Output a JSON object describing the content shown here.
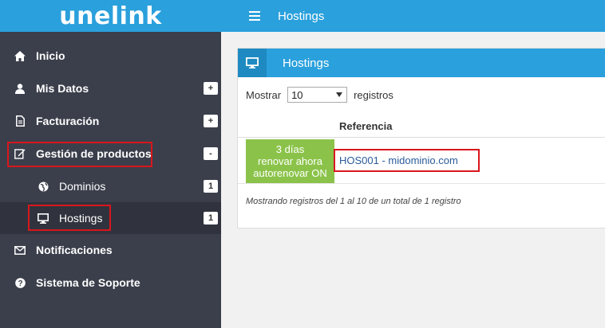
{
  "logo": "unelink",
  "topbar": {
    "title": "Hostings"
  },
  "sidebar": {
    "items": [
      {
        "label": "Inicio"
      },
      {
        "label": "Mis Datos",
        "badge": "+"
      },
      {
        "label": "Facturación",
        "badge": "+"
      },
      {
        "label": "Gestión de productos",
        "badge": "-"
      },
      {
        "label": "Dominios",
        "badge": "1"
      },
      {
        "label": "Hostings",
        "badge": "1"
      },
      {
        "label": "Notificaciones"
      },
      {
        "label": "Sistema de Soporte"
      }
    ]
  },
  "panel": {
    "title": "Hostings",
    "show_label": "Mostrar",
    "show_value": "10",
    "records_label": "registros",
    "column_header": "Referencia",
    "rows": [
      {
        "status": [
          "3 días",
          "renovar ahora",
          "autorenovar ON"
        ],
        "reference": "HOS001 - midominio.com"
      }
    ],
    "info": "Mostrando registros del 1 al 10 de un total de 1 registro"
  },
  "colors": {
    "brand": "#2aa0dc",
    "sidebar": "#3b3f4b",
    "status_green": "#8bc34a",
    "highlight": "#d9161c"
  }
}
